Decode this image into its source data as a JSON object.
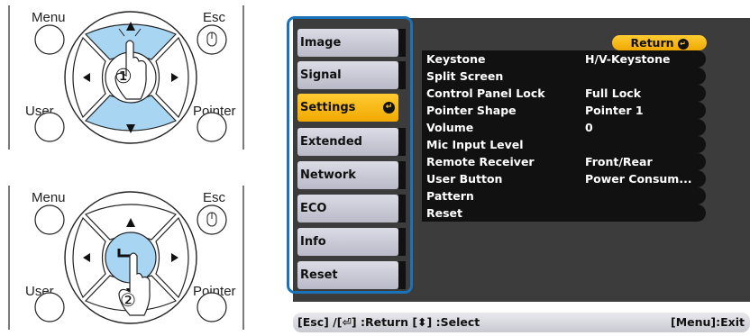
{
  "remote_top": {
    "menu_label": "Menu",
    "esc_label": "Esc",
    "user_label": "User",
    "pointer_label": "Pointer",
    "step_label": "①"
  },
  "remote_bottom": {
    "menu_label": "Menu",
    "esc_label": "Esc",
    "user_label": "User",
    "pointer_label": "Pointer",
    "step_label": "②"
  },
  "nav": {
    "items": [
      {
        "label": "Image"
      },
      {
        "label": "Signal"
      },
      {
        "label": "Settings"
      },
      {
        "label": "Extended"
      },
      {
        "label": "Network"
      },
      {
        "label": "ECO"
      },
      {
        "label": "Info"
      },
      {
        "label": "Reset"
      }
    ],
    "active_index": 2
  },
  "return_button": {
    "label": "Return"
  },
  "settings": [
    {
      "key": "Keystone",
      "value": "H/V-Keystone"
    },
    {
      "key": "Split Screen",
      "value": ""
    },
    {
      "key": "Control Panel Lock",
      "value": "Full Lock"
    },
    {
      "key": "Pointer Shape",
      "value": "Pointer 1"
    },
    {
      "key": "Volume",
      "value": "0"
    },
    {
      "key": "Mic Input Level",
      "value": ""
    },
    {
      "key": "Remote Receiver",
      "value": "Front/Rear"
    },
    {
      "key": "User Button",
      "value": "Power Consum..."
    },
    {
      "key": "Pattern",
      "value": ""
    },
    {
      "key": "Reset",
      "value": ""
    }
  ],
  "status_bar": {
    "left": "[Esc] /[⏎] :Return  [⬍] :Select",
    "right": "[Menu]:Exit"
  },
  "colors": {
    "accent": "#ffcc33",
    "frame": "#1a73b9",
    "highlight_blue": "#a8d6f2"
  }
}
